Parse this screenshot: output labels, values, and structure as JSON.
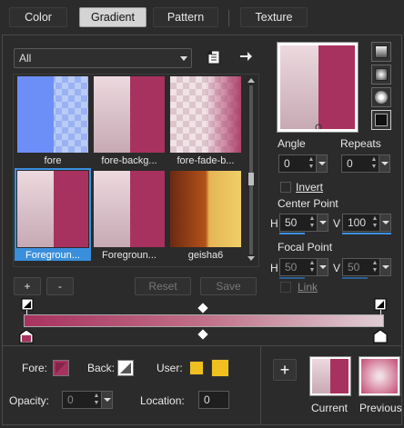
{
  "tabs": [
    {
      "label": "Color"
    },
    {
      "label": "Gradient"
    },
    {
      "label": "Pattern"
    },
    {
      "label": "Texture"
    }
  ],
  "active_tab": "Gradient",
  "category_dropdown": {
    "value": "All"
  },
  "gradients": [
    {
      "label": "fore"
    },
    {
      "label": "fore-backg..."
    },
    {
      "label": "fore-fade-b..."
    },
    {
      "label": "Foregroun...",
      "selected": true
    },
    {
      "label": "Foregroun..."
    },
    {
      "label": "geisha6"
    }
  ],
  "list_buttons": {
    "add": "+",
    "remove": "-",
    "reset": "Reset",
    "save": "Save"
  },
  "angle": {
    "label": "Angle",
    "value": "0"
  },
  "repeats": {
    "label": "Repeats",
    "value": "0"
  },
  "invert": {
    "label": "Invert"
  },
  "center_point": {
    "label": "Center Point",
    "h_label": "H",
    "h_value": "50",
    "v_label": "V",
    "v_value": "100"
  },
  "focal_point": {
    "label": "Focal Point",
    "h_label": "H",
    "h_value": "50",
    "v_label": "V",
    "v_value": "50"
  },
  "link": {
    "label": "Link"
  },
  "bottom": {
    "fore_label": "Fore:",
    "back_label": "Back:",
    "user_label": "User:",
    "opacity_label": "Opacity:",
    "opacity_value": "0",
    "location_label": "Location:",
    "location_value": "0",
    "current_label": "Current",
    "previous_label": "Previous"
  },
  "colors": {
    "accent": "#3a8fdd",
    "foreground": "#a8325f",
    "background": "#e0cdd4",
    "user": "#f0c020"
  }
}
